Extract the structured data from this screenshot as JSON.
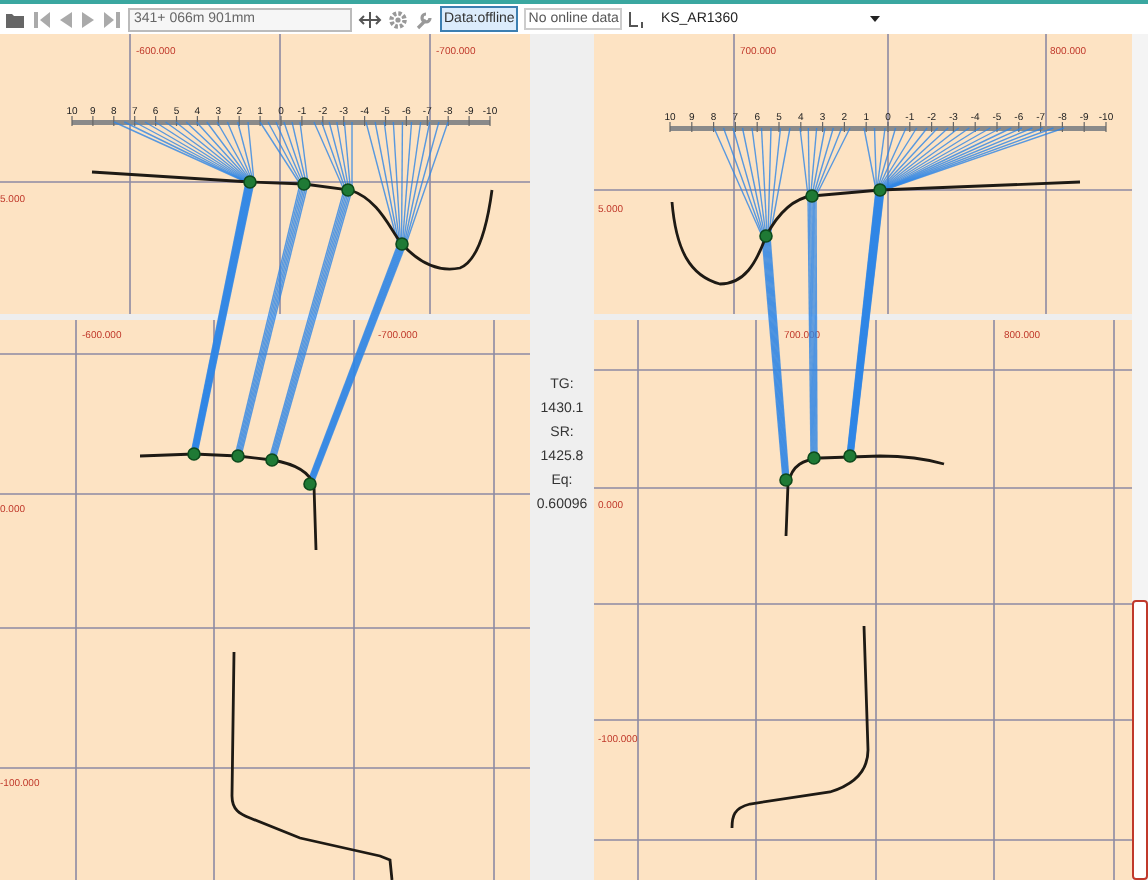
{
  "toolbar": {
    "position_field": {
      "value": "341+ 066m 901mm",
      "disabled": true
    },
    "data_mode": {
      "label": "Data:offline",
      "selected": true
    },
    "online_status": "No online data",
    "profile_select": {
      "value": "KS_AR1360"
    }
  },
  "plots": [
    {
      "top_labels": [
        "-600.000",
        "-700.000",
        "5.000"
      ],
      "ruler_ticks": [
        "10",
        "9",
        "8",
        "7",
        "6",
        "5",
        "4",
        "3",
        "2",
        "1",
        "0",
        "-1",
        "-2",
        "-3",
        "-4",
        "-5",
        "-6",
        "-7",
        "-8",
        "-9",
        "-10"
      ],
      "bottom_labels": [
        "-600.000",
        "-700.000",
        "0.000",
        "-100.000"
      ]
    },
    {
      "top_labels": [
        "700.000",
        "800.000",
        "5.000"
      ],
      "ruler_ticks": [
        "10",
        "9",
        "8",
        "7",
        "6",
        "5",
        "4",
        "3",
        "2",
        "1",
        "0",
        "-1",
        "-2",
        "-3",
        "-4",
        "-5",
        "-6",
        "-7",
        "-8",
        "-9",
        "-10"
      ],
      "bottom_labels": [
        "700.000",
        "800.000",
        "0.000",
        "-100.000"
      ]
    }
  ],
  "stats": [
    {
      "label": "TG:",
      "value": "1430.1"
    },
    {
      "label": "SR:",
      "value": "1425.8"
    },
    {
      "label": "Eq:",
      "value": "0.60096"
    }
  ]
}
